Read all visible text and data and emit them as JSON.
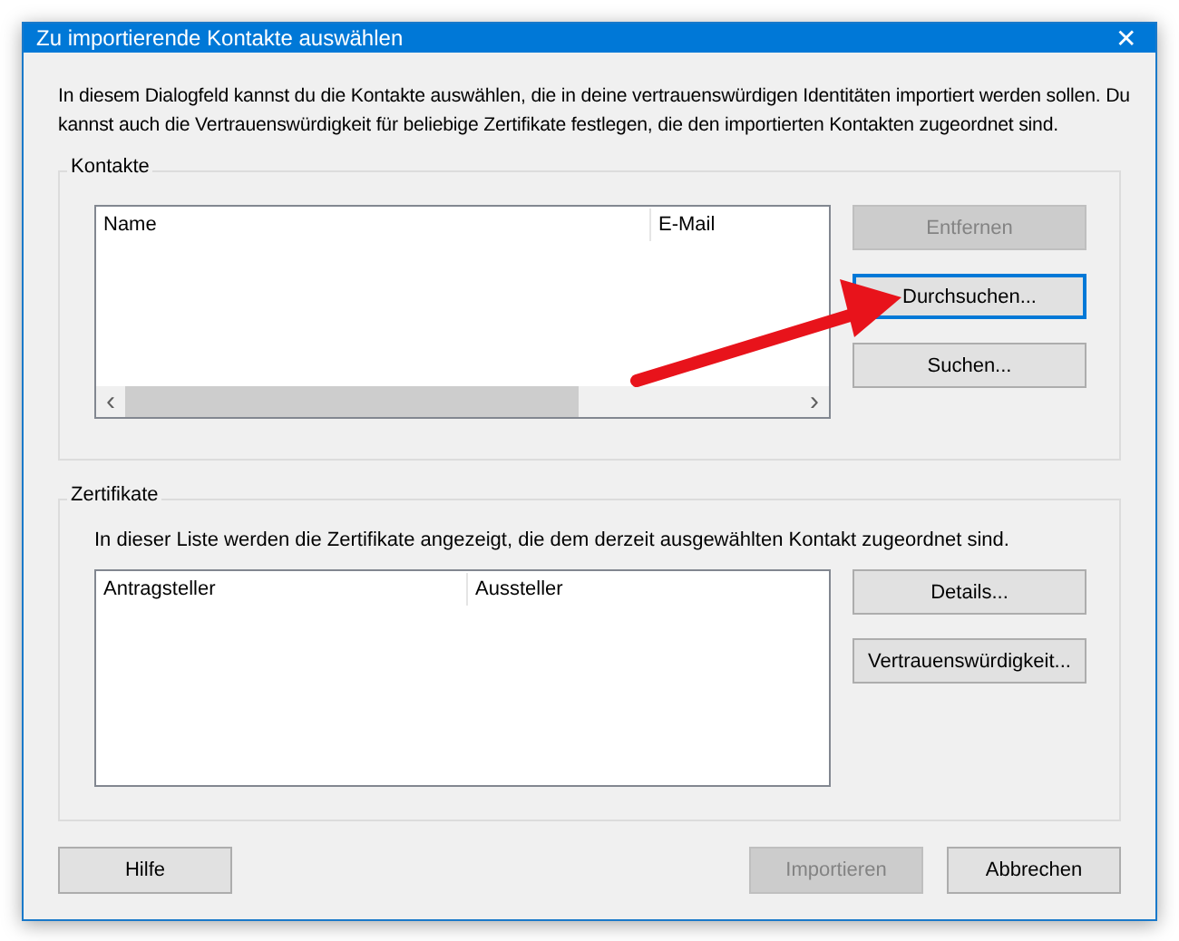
{
  "window": {
    "title": "Zu importierende Kontakte auswählen",
    "close": "✕"
  },
  "intro": "In diesem Dialogfeld kannst du die Kontakte auswählen, die in deine vertrauenswürdigen Identitäten importiert werden sollen. Du kannst auch die Vertrauenswürdigkeit für beliebige Zertifikate festlegen, die den importierten Kontakten zugeordnet sind.",
  "contacts": {
    "legend": "Kontakte",
    "columns": [
      "Name",
      "E-Mail"
    ],
    "scrollbar": {
      "left": "‹",
      "right": "›"
    },
    "buttons": [
      {
        "label": "Entfernen",
        "disabled": true,
        "focused": false
      },
      {
        "label": "Durchsuchen...",
        "disabled": false,
        "focused": true
      },
      {
        "label": "Suchen...",
        "disabled": false,
        "focused": false
      }
    ]
  },
  "certificates": {
    "legend": "Zertifikate",
    "description": "In dieser Liste werden die Zertifikate angezeigt, die dem derzeit ausgewählten Kontakt zugeordnet sind.",
    "columns": [
      "Antragsteller",
      "Aussteller"
    ],
    "buttons": [
      {
        "label": "Details...",
        "disabled": false,
        "focused": false
      },
      {
        "label": "Vertrauenswürdigkeit...",
        "disabled": false,
        "focused": false
      }
    ]
  },
  "footer": {
    "left": [
      {
        "label": "Hilfe",
        "disabled": false,
        "focused": false
      }
    ],
    "right": [
      {
        "label": "Importieren",
        "disabled": true,
        "focused": false
      },
      {
        "label": "Abbrechen",
        "disabled": false,
        "focused": false
      }
    ]
  }
}
